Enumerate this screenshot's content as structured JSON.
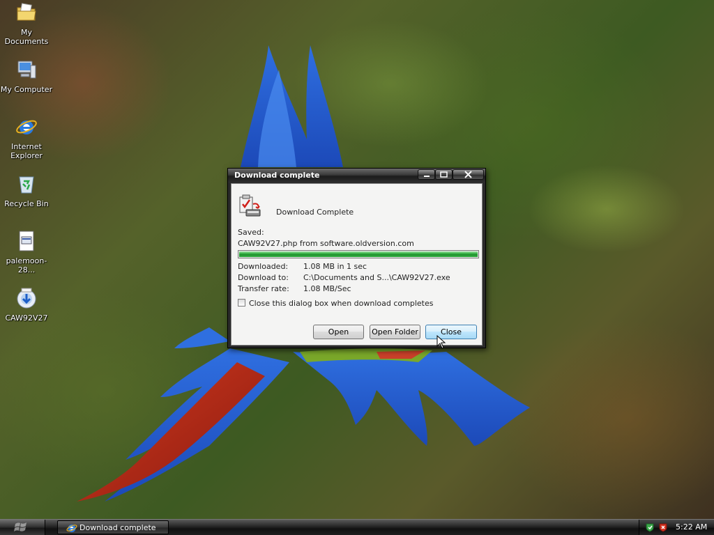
{
  "desktop": {
    "icons": [
      {
        "label": "My Documents",
        "icon": "my-documents-folder-icon"
      },
      {
        "label": "My Computer",
        "icon": "my-computer-icon"
      },
      {
        "label": "Internet Explorer",
        "icon": "internet-explorer-icon"
      },
      {
        "label": "Recycle Bin",
        "icon": "recycle-bin-icon"
      },
      {
        "label": "palemoon-28...",
        "icon": "file-icon"
      },
      {
        "label": "CAW92V27",
        "icon": "installer-icon"
      }
    ]
  },
  "dialog": {
    "title": "Download complete",
    "heading": "Download Complete",
    "saved_label": "Saved:",
    "saved_value": "CAW92V27.php from software.oldversion.com",
    "progress_percent": 100,
    "downloaded_label": "Downloaded:",
    "downloaded_value": "1.08 MB in 1 sec",
    "download_to_label": "Download to:",
    "download_to_value": "C:\\Documents and S...\\CAW92V27.exe",
    "transfer_rate_label": "Transfer rate:",
    "transfer_rate_value": "1.08 MB/Sec",
    "checkbox_label": "Close this dialog box when download completes",
    "checkbox_checked": false,
    "buttons": {
      "open": "Open",
      "open_folder": "Open Folder",
      "close": "Close"
    }
  },
  "taskbar": {
    "task_label": "Download complete",
    "clock": "5:22 AM"
  },
  "colors": {
    "progress": "#1c8f2a",
    "title_text": "#ffffff"
  }
}
